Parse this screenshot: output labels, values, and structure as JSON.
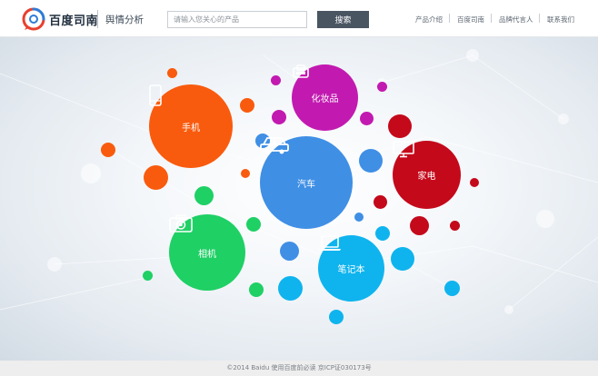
{
  "header": {
    "brand": "百度司南",
    "product": "舆情分析",
    "search_placeholder": "请输入您关心的产品",
    "search_button": "搜索",
    "nav": [
      "产品介绍",
      "百度司南",
      "品牌代言人",
      "联系我们"
    ]
  },
  "categories": [
    {
      "label": "手机",
      "icon": "phone-icon",
      "color": "#f95b0e"
    },
    {
      "label": "化妆品",
      "icon": "cosmetics-icon",
      "color": "#c21ab0"
    },
    {
      "label": "汽车",
      "icon": "car-icon",
      "color": "#3f8fe5"
    },
    {
      "label": "家电",
      "icon": "tv-icon",
      "color": "#c4091b"
    },
    {
      "label": "相机",
      "icon": "camera-icon",
      "color": "#1fd065"
    },
    {
      "label": "笔记本",
      "icon": "laptop-icon",
      "color": "#0fb4ee"
    }
  ],
  "colors": {
    "orange": "#f95b0e",
    "purple": "#c21ab0",
    "blue": "#3f8fe5",
    "red": "#c4091b",
    "green": "#1fd065",
    "cyan": "#0fb4ee"
  },
  "footer": "©2014 Baidu 使用百度前必读 京ICP证030173号"
}
